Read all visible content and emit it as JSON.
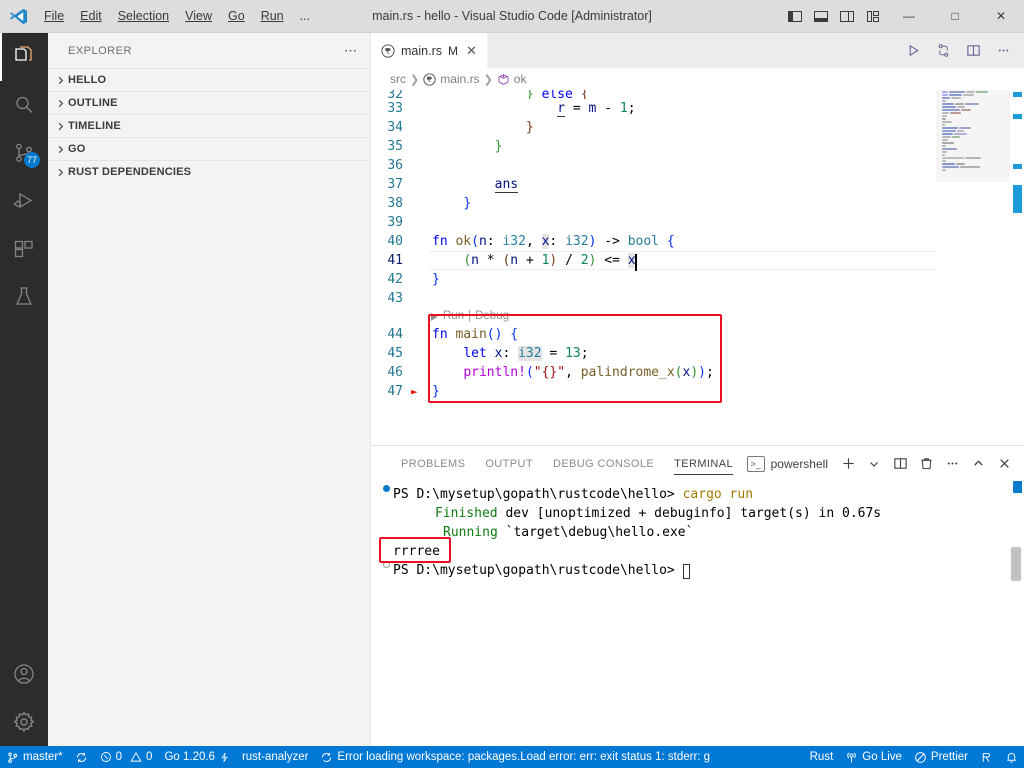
{
  "titlebar": {
    "window_title": "main.rs - hello - Visual Studio Code [Administrator]",
    "menus": [
      {
        "label": "File",
        "mnemonic": "F"
      },
      {
        "label": "Edit",
        "mnemonic": "E"
      },
      {
        "label": "Selection",
        "mnemonic": "S"
      },
      {
        "label": "View",
        "mnemonic": "V"
      },
      {
        "label": "Go",
        "mnemonic": "G"
      },
      {
        "label": "Run",
        "mnemonic": "R"
      },
      {
        "label": "...",
        "mnemonic": ""
      }
    ],
    "layout_buttons": [
      "toggle-primary-sidebar",
      "toggle-panel",
      "toggle-secondary-sidebar",
      "customize-layout"
    ],
    "window_controls": {
      "minimize": "—",
      "maximize": "□",
      "close": "✕"
    }
  },
  "activitybar": {
    "items": [
      {
        "name": "explorer",
        "active": true,
        "badge": ""
      },
      {
        "name": "search",
        "active": false,
        "badge": ""
      },
      {
        "name": "source-control",
        "active": false,
        "badge": "77"
      },
      {
        "name": "run-and-debug",
        "active": false,
        "badge": ""
      },
      {
        "name": "extensions",
        "active": false,
        "badge": ""
      },
      {
        "name": "testing",
        "active": false,
        "badge": ""
      }
    ],
    "bottom": [
      {
        "name": "accounts"
      },
      {
        "name": "manage-settings"
      }
    ]
  },
  "sidebar": {
    "title": "EXPLORER",
    "more_actions": "⋯",
    "sections": [
      {
        "label": "HELLO",
        "expanded": false
      },
      {
        "label": "OUTLINE",
        "expanded": false
      },
      {
        "label": "TIMELINE",
        "expanded": false
      },
      {
        "label": "GO",
        "expanded": false
      },
      {
        "label": "RUST DEPENDENCIES",
        "expanded": false
      }
    ]
  },
  "editor": {
    "tab": {
      "label": "main.rs",
      "dirty_indicator": "M",
      "close": "✕"
    },
    "actions": [
      "run-code",
      "run-and-debug-alt",
      "split-editor-right",
      "more-actions"
    ],
    "breadcrumbs": [
      {
        "label": "src",
        "icon": ""
      },
      {
        "label": "main.rs",
        "icon": "rust-icon"
      },
      {
        "label": "ok",
        "icon": "symbol-function-icon"
      }
    ],
    "codelens": {
      "run": "Run",
      "separator": "|",
      "debug": "Debug"
    },
    "lines": [
      {
        "num": "32",
        "partial_top": true,
        "text": "            } else {"
      },
      {
        "num": "33",
        "text": "                r = m - 1;"
      },
      {
        "num": "34",
        "text": "            }"
      },
      {
        "num": "35",
        "text": "        }"
      },
      {
        "num": "36",
        "text": ""
      },
      {
        "num": "37",
        "text": "        ans"
      },
      {
        "num": "38",
        "text": "    }"
      },
      {
        "num": "39",
        "text": ""
      },
      {
        "num": "40",
        "text": "fn ok(n: i32, x: i32) -> bool {"
      },
      {
        "num": "41",
        "text": "    (n * (n + 1) / 2) <= x"
      },
      {
        "num": "42",
        "text": "}"
      },
      {
        "num": "43",
        "text": ""
      },
      {
        "num": "44",
        "text": "fn main() {"
      },
      {
        "num": "45",
        "text": "    let x: i32 = 13;"
      },
      {
        "num": "46",
        "text": "    println!(\"{}\", palindrome_x(x));"
      },
      {
        "num": "47",
        "text": "}"
      }
    ],
    "highlight_box_label": "main-function-highlight",
    "highlight_color": "#e81123"
  },
  "panel": {
    "tabs": [
      {
        "label": "PROBLEMS",
        "active": false
      },
      {
        "label": "OUTPUT",
        "active": false
      },
      {
        "label": "DEBUG CONSOLE",
        "active": false
      },
      {
        "label": "TERMINAL",
        "active": true
      }
    ],
    "terminal_name": "powershell",
    "actions": [
      "new-terminal",
      "terminal-dropdown",
      "split-terminal",
      "kill-terminal",
      "more-actions",
      "maximize-panel",
      "close-panel"
    ],
    "terminal": {
      "prompt1": "PS D:\\mysetup\\gopath\\rustcode\\hello>",
      "command1": "cargo run",
      "line_finished_label": "Finished",
      "line_finished_rest": "dev [unoptimized + debuginfo] target(s) in 0.67s",
      "line_running_label": "Running",
      "line_running_rest": "`target\\debug\\hello.exe`",
      "output": "rrrree",
      "prompt2": "PS D:\\mysetup\\gopath\\rustcode\\hello>"
    },
    "output_highlight_color": "#e81123"
  },
  "statusbar": {
    "branch": "master*",
    "sync_icon": "sync-icon",
    "errors": "0",
    "warnings": "0",
    "go_version": "Go 1.20.6",
    "rust_analyzer": "rust-analyzer",
    "workspace_error": "Error loading workspace: packages.Load error: err: exit status 1: stderr: g",
    "language_mode": "Rust",
    "go_live": "Go Live",
    "prettier": "Prettier",
    "remote_icon": "remote-window-icon",
    "bell_icon": "notifications-bell-icon",
    "background_color": "#0078d4"
  }
}
